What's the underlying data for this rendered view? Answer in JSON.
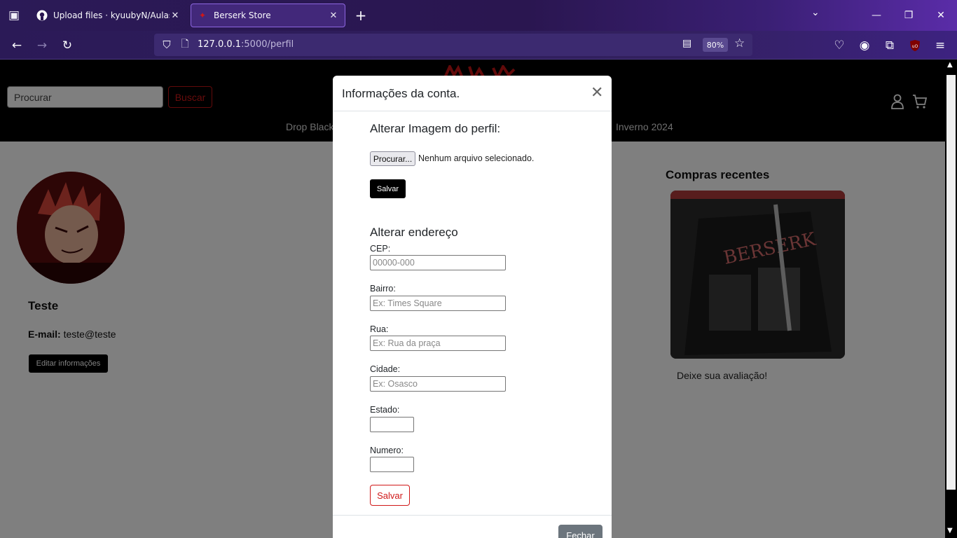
{
  "browser": {
    "tabs": [
      {
        "title": "Upload files · kyuubyN/AulasFra",
        "active": false,
        "icon": "github-icon"
      },
      {
        "title": "Berserk Store",
        "active": true,
        "icon": "berserk-favicon"
      }
    ],
    "new_tab": "+",
    "url": {
      "host": "127.0.0.1",
      "path": ":5000/perfil"
    },
    "zoom": "80%"
  },
  "header": {
    "search_placeholder": "Procurar",
    "search_button": "Buscar",
    "nav": [
      "Drop Black",
      "Inverno 2024"
    ]
  },
  "profile": {
    "name": "Teste",
    "email_label": "E-mail:",
    "email": "teste@teste",
    "edit_button": "Editar informações"
  },
  "recent": {
    "title": "Compras recentes",
    "review": "Deixe sua avaliação!"
  },
  "modal": {
    "title": "Informações da conta.",
    "image_section": "Alterar Imagem do perfil:",
    "file_button": "Procurar...",
    "file_status": "Nenhum arquivo selecionado.",
    "save_image": "Salvar",
    "address_section": "Alterar endereço",
    "fields": {
      "cep": {
        "label": "CEP:",
        "placeholder": "00000-000"
      },
      "bairro": {
        "label": "Bairro:",
        "placeholder": "Ex: Times Square"
      },
      "rua": {
        "label": "Rua:",
        "placeholder": "Ex: Rua da praça"
      },
      "cidade": {
        "label": "Cidade:",
        "placeholder": "Ex: Osasco"
      },
      "estado": {
        "label": "Estado:",
        "placeholder": ""
      },
      "numero": {
        "label": "Numero:",
        "placeholder": ""
      }
    },
    "save_address": "Salvar",
    "close_button": "Fechar"
  },
  "colors": {
    "accent_red": "#d01818",
    "chrome_purple": "#2b1a57",
    "header_black": "#000000"
  }
}
